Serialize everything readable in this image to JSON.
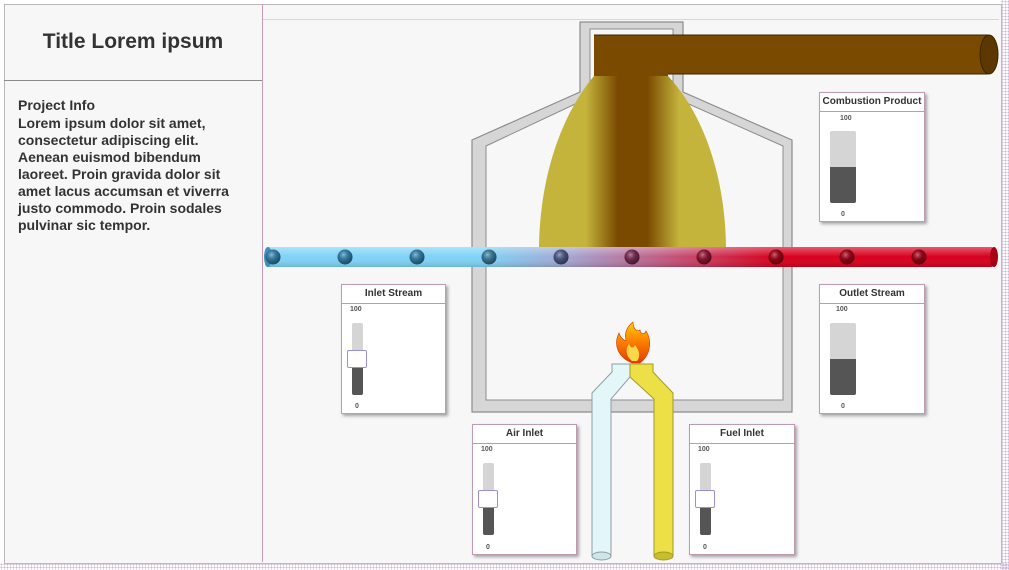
{
  "title": "Title Lorem ipsum",
  "project_info": {
    "heading": "Project Info",
    "body": "Lorem ipsum dolor sit amet, consectetur adipiscing elit. Aenean euismod bibendum laoreet. Proin gravida dolor sit amet lacus accumsan et viverra justo commodo. Proin sodales pulvinar sic tempor."
  },
  "colors": {
    "inlet_stream": "#7fd3f7",
    "outlet_stream": "#d8001d",
    "exhaust": "#7a4a00",
    "flame_glow": "#c4b43c",
    "air_pipe": "#e3f6f8",
    "fuel_pipe": "#ece046",
    "gauge_fill": "#555555"
  },
  "gauges": {
    "combustion_product": {
      "title": "Combustion Product",
      "max": "100",
      "min": "0",
      "level": 0.5,
      "kind": "bar"
    },
    "inlet_stream": {
      "title": "Inlet Stream",
      "max": "100",
      "min": "0",
      "level": 0.5,
      "kind": "slider"
    },
    "outlet_stream": {
      "title": "Outlet Stream",
      "max": "100",
      "min": "0",
      "level": 0.5,
      "kind": "bar"
    },
    "air_inlet": {
      "title": "Air Inlet",
      "max": "100",
      "min": "0",
      "level": 0.5,
      "kind": "slider"
    },
    "fuel_inlet": {
      "title": "Fuel Inlet",
      "max": "100",
      "min": "0",
      "level": 0.5,
      "kind": "slider"
    }
  },
  "icons": {
    "burner_flame": "flame-icon"
  }
}
